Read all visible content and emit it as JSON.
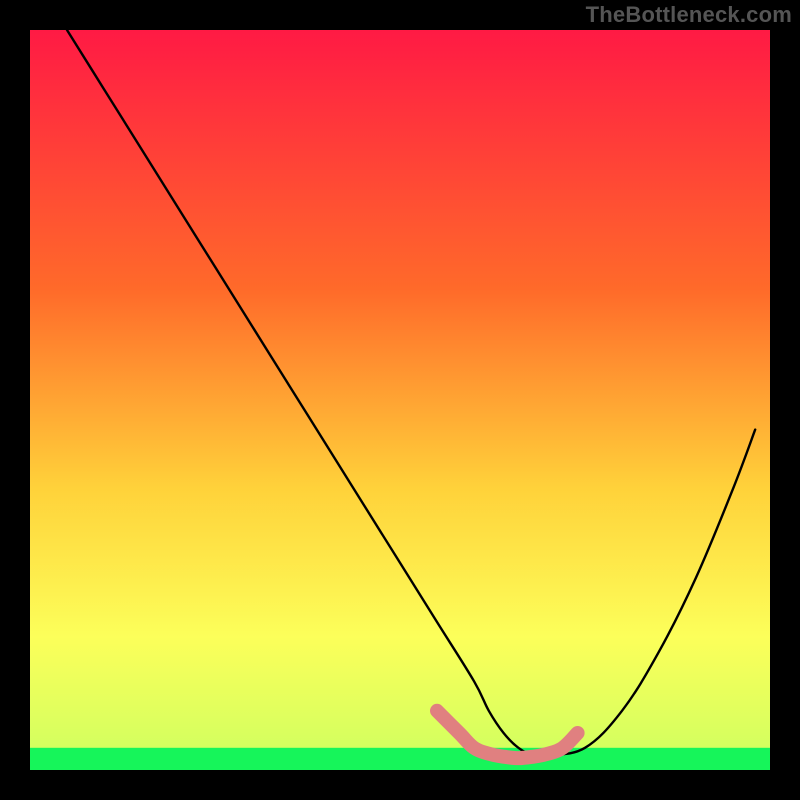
{
  "watermark": "TheBottleneck.com",
  "colors": {
    "black": "#000000",
    "curve": "#000000",
    "pink_marker": "#e08080",
    "green_band": "#16f55a",
    "gradient_top": "#ff1a44",
    "gradient_mid1": "#ff6a2a",
    "gradient_mid2": "#ffd23a",
    "gradient_mid3": "#fcff5a",
    "gradient_bottom": "#ccff60"
  },
  "chart_data": {
    "type": "line",
    "title": "",
    "xlabel": "",
    "ylabel": "",
    "xlim": [
      0,
      100
    ],
    "ylim": [
      0,
      100
    ],
    "x": [
      5,
      10,
      15,
      20,
      25,
      30,
      35,
      40,
      45,
      50,
      55,
      60,
      62,
      64,
      66,
      68,
      70,
      75,
      80,
      85,
      90,
      95,
      98
    ],
    "values": [
      100,
      92,
      84,
      76,
      68,
      60,
      52,
      44,
      36,
      28,
      20,
      12,
      8,
      5,
      3,
      2,
      2,
      3,
      8,
      16,
      26,
      38,
      46
    ],
    "marker_segment": {
      "x": [
        55,
        58,
        60,
        62,
        64,
        66,
        68,
        70,
        72,
        74
      ],
      "values": [
        8,
        5,
        3,
        2.2,
        1.8,
        1.6,
        1.8,
        2.2,
        3,
        5
      ]
    },
    "green_band_y": [
      0,
      3
    ],
    "background_gradient_stops": [
      {
        "offset": 0.0,
        "value": 100
      },
      {
        "offset": 0.35,
        "value": 65
      },
      {
        "offset": 0.65,
        "value": 35
      },
      {
        "offset": 0.85,
        "value": 15
      },
      {
        "offset": 1.0,
        "value": 0
      }
    ]
  }
}
